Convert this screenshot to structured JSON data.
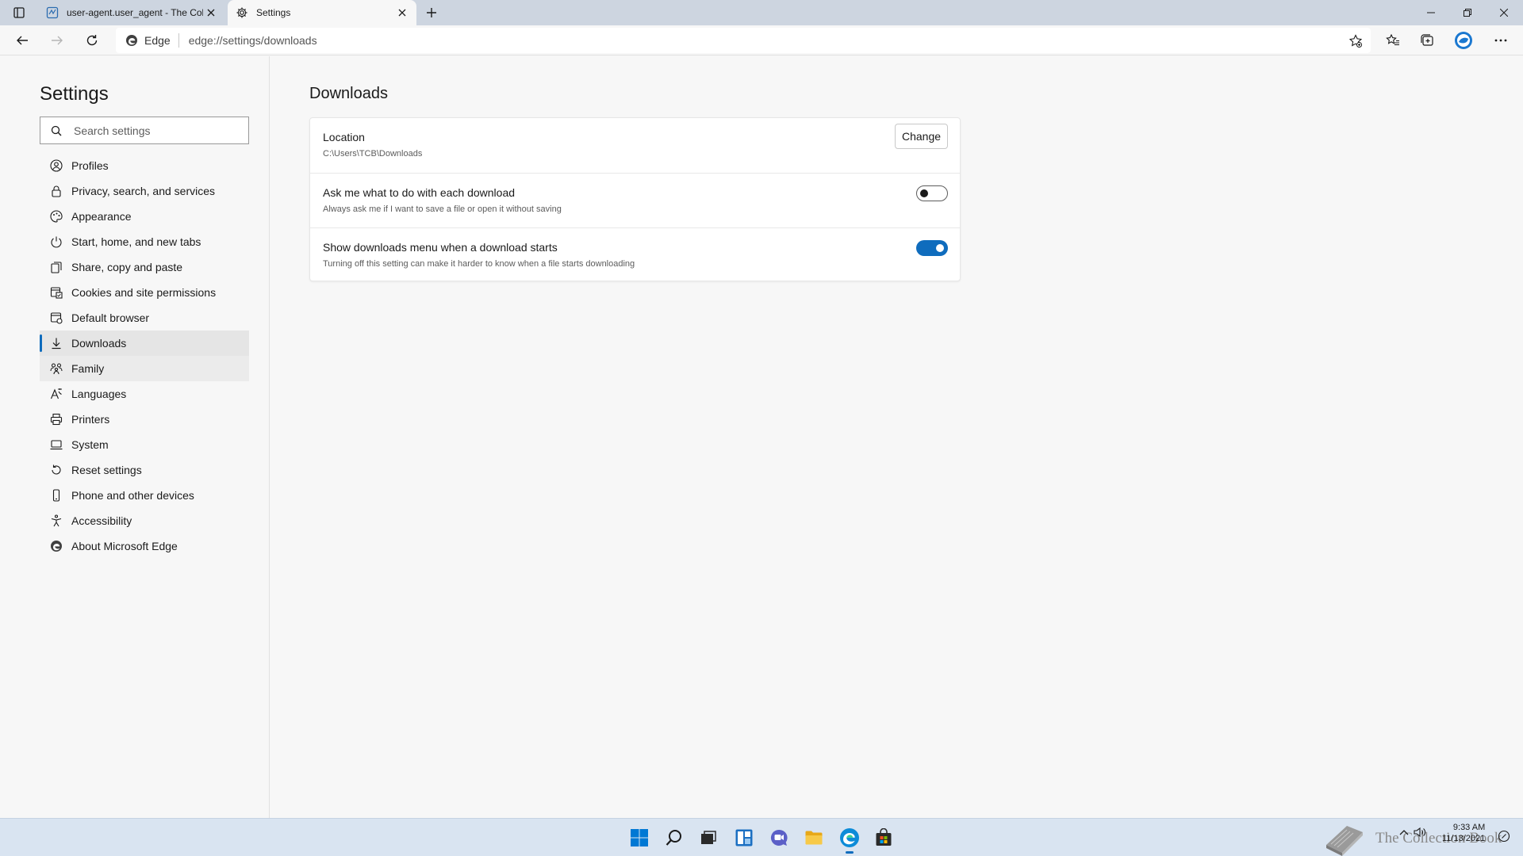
{
  "tabs": [
    {
      "title": "user-agent.user_agent - The Coll",
      "favicon": "document-icon",
      "active": false
    },
    {
      "title": "Settings",
      "favicon": "gear-icon",
      "active": true
    }
  ],
  "toolbar": {
    "site_identity": "Edge",
    "url": "edge://settings/downloads"
  },
  "sidebar": {
    "title": "Settings",
    "search_placeholder": "Search settings",
    "items": [
      {
        "label": "Profiles",
        "icon": "profile-icon"
      },
      {
        "label": "Privacy, search, and services",
        "icon": "lock-icon"
      },
      {
        "label": "Appearance",
        "icon": "appearance-icon"
      },
      {
        "label": "Start, home, and new tabs",
        "icon": "power-icon"
      },
      {
        "label": "Share, copy and paste",
        "icon": "share-icon"
      },
      {
        "label": "Cookies and site permissions",
        "icon": "cookies-icon"
      },
      {
        "label": "Default browser",
        "icon": "browser-icon"
      },
      {
        "label": "Downloads",
        "icon": "download-icon",
        "selected": true
      },
      {
        "label": "Family",
        "icon": "family-icon"
      },
      {
        "label": "Languages",
        "icon": "languages-icon"
      },
      {
        "label": "Printers",
        "icon": "printer-icon"
      },
      {
        "label": "System",
        "icon": "system-icon"
      },
      {
        "label": "Reset settings",
        "icon": "reset-icon"
      },
      {
        "label": "Phone and other devices",
        "icon": "phone-icon"
      },
      {
        "label": "Accessibility",
        "icon": "accessibility-icon"
      },
      {
        "label": "About Microsoft Edge",
        "icon": "edge-icon"
      }
    ]
  },
  "main": {
    "title": "Downloads",
    "location": {
      "label": "Location",
      "path": "C:\\Users\\TCB\\Downloads",
      "button": "Change"
    },
    "ask_each": {
      "label": "Ask me what to do with each download",
      "description": "Always ask me if I want to save a file or open it without saving",
      "enabled": false
    },
    "show_menu": {
      "label": "Show downloads menu when a download starts",
      "description": "Turning off this setting can make it harder to know when a file starts downloading",
      "enabled": true
    }
  },
  "taskbar": {
    "watermark": "The Collection Book",
    "time": "9:33 AM",
    "date": "11/13/2021"
  },
  "colors": {
    "accent": "#0f6cbd",
    "tabstrip": "#cdd5e0",
    "taskbar": "#d9e4f1"
  }
}
